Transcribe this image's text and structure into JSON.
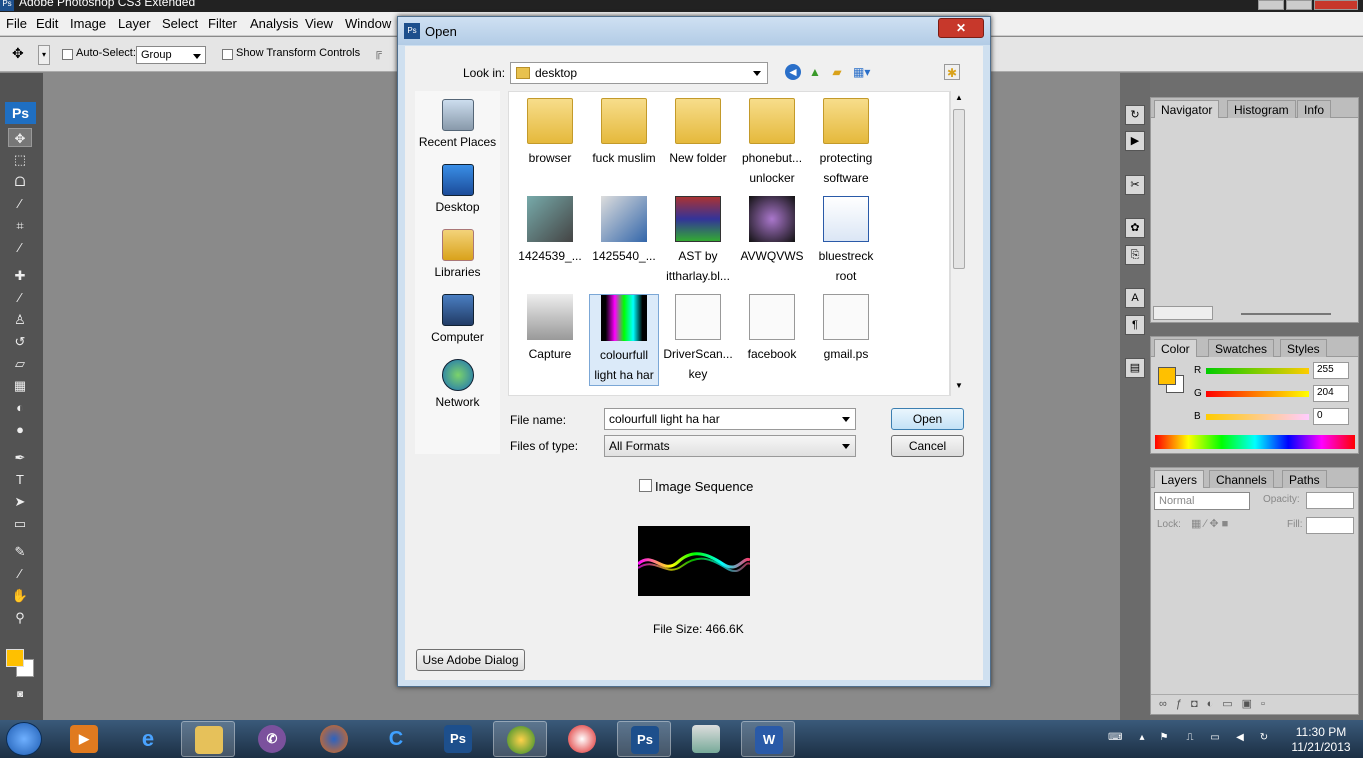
{
  "app": {
    "title": "Adobe Photoshop CS3 Extended",
    "logo": "Ps"
  },
  "menu": [
    "File",
    "Edit",
    "Image",
    "Layer",
    "Select",
    "Filter",
    "Analysis",
    "View",
    "Window"
  ],
  "options": {
    "auto_select_label": "Auto-Select:",
    "auto_select_value": "Group",
    "show_transform_label": "Show Transform Controls"
  },
  "tools": [
    "move-tool-icon",
    "marquee-tool-icon",
    "lasso-tool-icon",
    "magic-wand-icon",
    "crop-tool-icon",
    "slice-tool-icon",
    "healing-brush-icon",
    "brush-tool-icon",
    "clone-stamp-icon",
    "history-brush-icon",
    "eraser-icon",
    "gradient-tool-icon",
    "blur-tool-icon",
    "dodge-tool-icon",
    "pen-tool-icon",
    "type-tool-icon",
    "path-selection-icon",
    "shape-tool-icon",
    "notes-tool-icon",
    "eyedropper-icon",
    "hand-tool-icon",
    "zoom-tool-icon"
  ],
  "colors": {
    "foreground": "#ffc000",
    "background": "#ffffff",
    "dialog_title_bg": "#b3cce6",
    "close_red": "#c7382b"
  },
  "panels": {
    "navigator_tabs": [
      "Navigator",
      "Histogram",
      "Info"
    ],
    "color_tabs": [
      "Color",
      "Swatches",
      "Styles"
    ],
    "color": {
      "r_label": "R",
      "g_label": "G",
      "b_label": "B",
      "r": "255",
      "g": "204",
      "b": "0"
    },
    "layers_tabs": [
      "Layers",
      "Channels",
      "Paths"
    ],
    "layers": {
      "blend_mode": "Normal",
      "opacity_label": "Opacity:",
      "lock_label": "Lock:",
      "fill_label": "Fill:"
    }
  },
  "dialog": {
    "title": "Open",
    "look_in_label": "Look in:",
    "look_in_value": "desktop",
    "places": [
      "Recent Places",
      "Desktop",
      "Libraries",
      "Computer",
      "Network"
    ],
    "files": [
      {
        "name": "browser",
        "kind": "folder"
      },
      {
        "name": "fuck muslim",
        "kind": "folder"
      },
      {
        "name": "New folder",
        "kind": "folder"
      },
      {
        "name": "phonebut... unlocker",
        "kind": "folder"
      },
      {
        "name": "protecting software",
        "kind": "folder"
      },
      {
        "name": "1424539_...",
        "kind": "image"
      },
      {
        "name": "1425540_...",
        "kind": "image"
      },
      {
        "name": "AST by ittharlay.bl...",
        "kind": "archive"
      },
      {
        "name": "AVWQVWS",
        "kind": "image"
      },
      {
        "name": "bluestreck root",
        "kind": "document"
      },
      {
        "name": "Capture",
        "kind": "image"
      },
      {
        "name": "colourfull light ha har",
        "kind": "image",
        "selected": true
      },
      {
        "name": "DriverScan... key",
        "kind": "document"
      },
      {
        "name": "facebook",
        "kind": "document"
      },
      {
        "name": "gmail.ps",
        "kind": "document"
      }
    ],
    "file_name_label": "File name:",
    "file_name_value": "colourfull light ha har",
    "files_of_type_label": "Files of type:",
    "files_of_type_value": "All Formats",
    "open_label": "Open",
    "cancel_label": "Cancel",
    "image_sequence_label": "Image Sequence",
    "file_size": "File Size: 466.6K",
    "use_adobe_dialog_label": "Use Adobe Dialog"
  },
  "taskbar": {
    "apps": [
      "media-player-icon",
      "internet-explorer-icon",
      "file-explorer-icon",
      "viber-icon",
      "firefox-icon",
      "ccleaner-icon",
      "photoshop-icon",
      "globe-app-icon",
      "satellite-app-icon",
      "photoshop-active-icon",
      "network-app-icon",
      "word-icon"
    ],
    "time": "11:30 PM",
    "date": "11/21/2013"
  }
}
